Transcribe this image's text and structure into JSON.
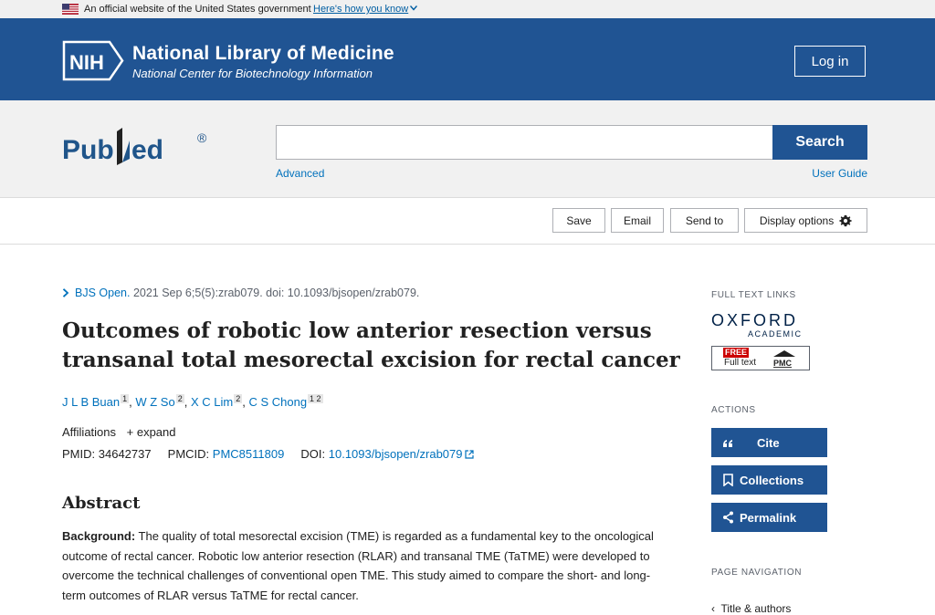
{
  "gov_banner": {
    "text": "An official website of the United States government",
    "link": "Here's how you know"
  },
  "header": {
    "nih_logo_text": "NIH",
    "title": "National Library of Medicine",
    "subtitle": "National Center for Biotechnology Information",
    "login_label": "Log in"
  },
  "search": {
    "logo_text": "PubMed",
    "value": "",
    "placeholder": "",
    "button_label": "Search",
    "advanced_label": "Advanced",
    "guide_label": "User Guide"
  },
  "toolbar": {
    "save_label": "Save",
    "email_label": "Email",
    "sendto_label": "Send to",
    "display_label": "Display options"
  },
  "article": {
    "journal_name": "BJS Open.",
    "citation": "2021 Sep 6;5(5):zrab079. doi: 10.1093/bjsopen/zrab079.",
    "title": "Outcomes of robotic low anterior resection versus transanal total mesorectal excision for rectal cancer",
    "authors": [
      {
        "name": "J L B Buan",
        "affils": "1"
      },
      {
        "name": "W Z So",
        "affils": "2"
      },
      {
        "name": "X C Lim",
        "affils": "2"
      },
      {
        "name": "C S Chong",
        "affils": "1 2"
      }
    ],
    "affiliations_label": "Affiliations",
    "expand_label": "+ expand",
    "pmid_label": "PMID:",
    "pmid": "34642737",
    "pmcid_label": "PMCID:",
    "pmcid": "PMC8511809",
    "doi_label": "DOI:",
    "doi": "10.1093/bjsopen/zrab079",
    "abstract_heading": "Abstract",
    "abstract_bg_label": "Background:",
    "abstract_bg_text": " The quality of total mesorectal excision (TME) is regarded as a fundamental key to the oncological outcome of rectal cancer. Robotic low anterior resection (RLAR) and transanal TME (TaTME) were developed to overcome the technical challenges of conventional open TME. This study aimed to compare the short- and long-term outcomes of RLAR versus TaTME for rectal cancer."
  },
  "sidebar": {
    "fulltext_label": "FULL TEXT LINKS",
    "oxford_line1": "OXFORD",
    "oxford_line2": "ACADEMIC",
    "pmc_free": "FREE",
    "pmc_fulltext": "Full text",
    "pmc_mark": "PMC",
    "actions_label": "ACTIONS",
    "cite_label": "Cite",
    "collections_label": "Collections",
    "permalink_label": "Permalink",
    "pagenav_label": "PAGE NAVIGATION",
    "pagenav_first": "Title & authors"
  },
  "colors": {
    "nih_blue": "#205493",
    "link_blue": "#0071bc",
    "pubmed_logo_blue": "#20558a"
  }
}
